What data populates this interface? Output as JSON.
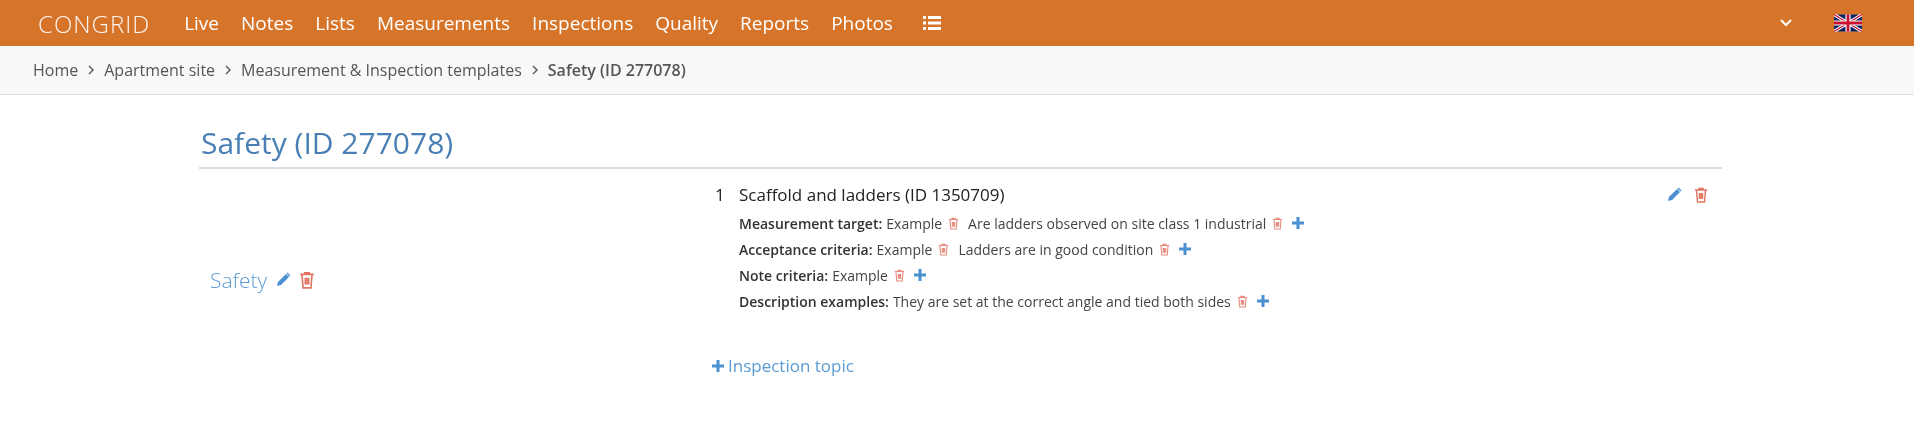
{
  "navbar": {
    "logo": "CONGRID",
    "links": [
      "Live",
      "Notes",
      "Lists",
      "Measurements",
      "Inspections",
      "Quality",
      "Reports",
      "Photos"
    ]
  },
  "breadcrumb": {
    "items": [
      "Home",
      "Apartment site",
      "Measurement & Inspection templates"
    ],
    "current": "Safety (ID 277078)"
  },
  "page_title": "Safety (ID 277078)",
  "category": {
    "name": "Safety"
  },
  "topics": [
    {
      "number": "1",
      "title": "Scaffold and ladders (ID 1350709)",
      "fields": [
        {
          "label": "Measurement target:",
          "values": [
            "Example",
            "Are ladders observed on site class 1 industrial"
          ]
        },
        {
          "label": "Acceptance criteria:",
          "values": [
            "Example",
            "Ladders are in good condition"
          ]
        },
        {
          "label": "Note criteria:",
          "values": [
            "Example"
          ]
        },
        {
          "label": "Description examples:",
          "values": [
            "They are set at the correct angle and tied both sides"
          ]
        }
      ]
    }
  ],
  "add_topic": "Inspection topic"
}
